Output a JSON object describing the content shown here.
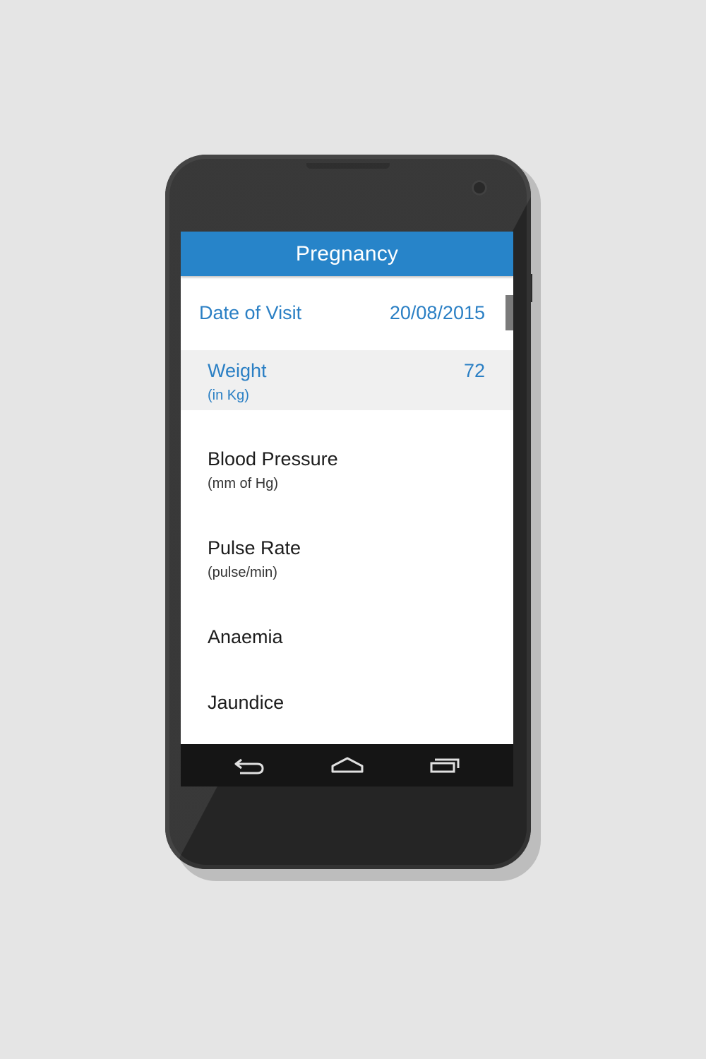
{
  "app_bar": {
    "title": "Pregnancy"
  },
  "date_of_visit": {
    "label": "Date of Visit",
    "value": "20/08/2015"
  },
  "fields": [
    {
      "label": "Weight",
      "unit": "(in Kg)",
      "value": "72",
      "active": true
    },
    {
      "label": "Blood Pressure",
      "unit": "(mm of Hg)",
      "value": ""
    },
    {
      "label": "Pulse Rate",
      "unit": "(pulse/min)",
      "value": ""
    },
    {
      "label": "Anaemia",
      "unit": "",
      "value": ""
    },
    {
      "label": "Jaundice",
      "unit": "",
      "value": ""
    }
  ],
  "navigation": {
    "buttons": [
      "back-icon",
      "home-icon",
      "recent-apps-icon"
    ]
  },
  "colors": {
    "accent": "#2784c9",
    "active_row": "#f0f0f0",
    "nav_bar": "#151515",
    "background": "#e5e5e5"
  }
}
